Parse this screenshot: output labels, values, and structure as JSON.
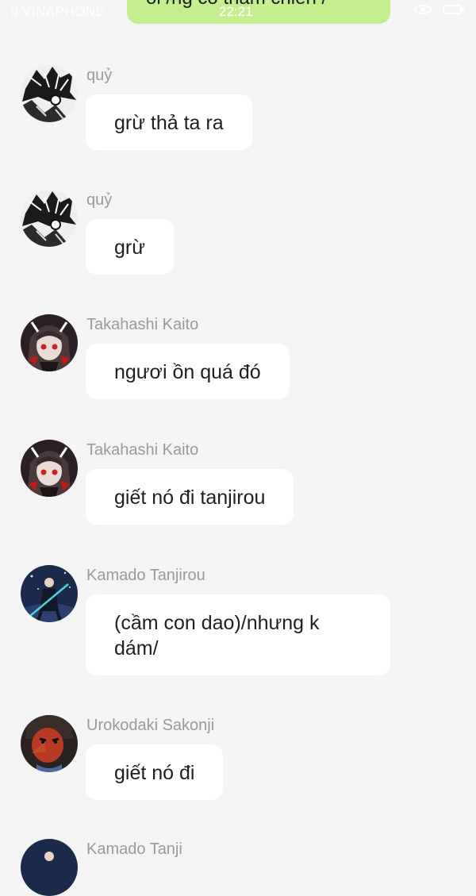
{
  "status_bar": {
    "carrier": ".ıl VINAPHONE",
    "time": "22:21"
  },
  "top_bubble": {
    "text": "ôi /ng cô thảm chiến /"
  },
  "messages": [
    {
      "sender": "quỷ",
      "text": "grừ thả ta ra",
      "avatar": "manga-demon-avatar"
    },
    {
      "sender": "quỷ",
      "text": "grừ",
      "avatar": "manga-demon-avatar"
    },
    {
      "sender": "Takahashi Kaito",
      "text": "ngươi ồn quá đó",
      "avatar": "dark-hooded-girl-avatar"
    },
    {
      "sender": "Takahashi Kaito",
      "text": "giết nó đi tanjirou",
      "avatar": "dark-hooded-girl-avatar"
    },
    {
      "sender": "Kamado Tanjirou",
      "text": "(cầm con dao)/nhưng k dám/",
      "avatar": "night-swordsman-avatar"
    },
    {
      "sender": "Urokodaki Sakonji",
      "text": "giết nó đi",
      "avatar": "red-tengu-mask-avatar"
    },
    {
      "sender": "Kamado Tanji",
      "text": "",
      "avatar": "night-swordsman-avatar"
    }
  ],
  "colors": {
    "background": "#f4f4f4",
    "bubble": "#ffffff",
    "self_bubble": "#c5ee8f",
    "sender_name": "#9a9a9a"
  }
}
